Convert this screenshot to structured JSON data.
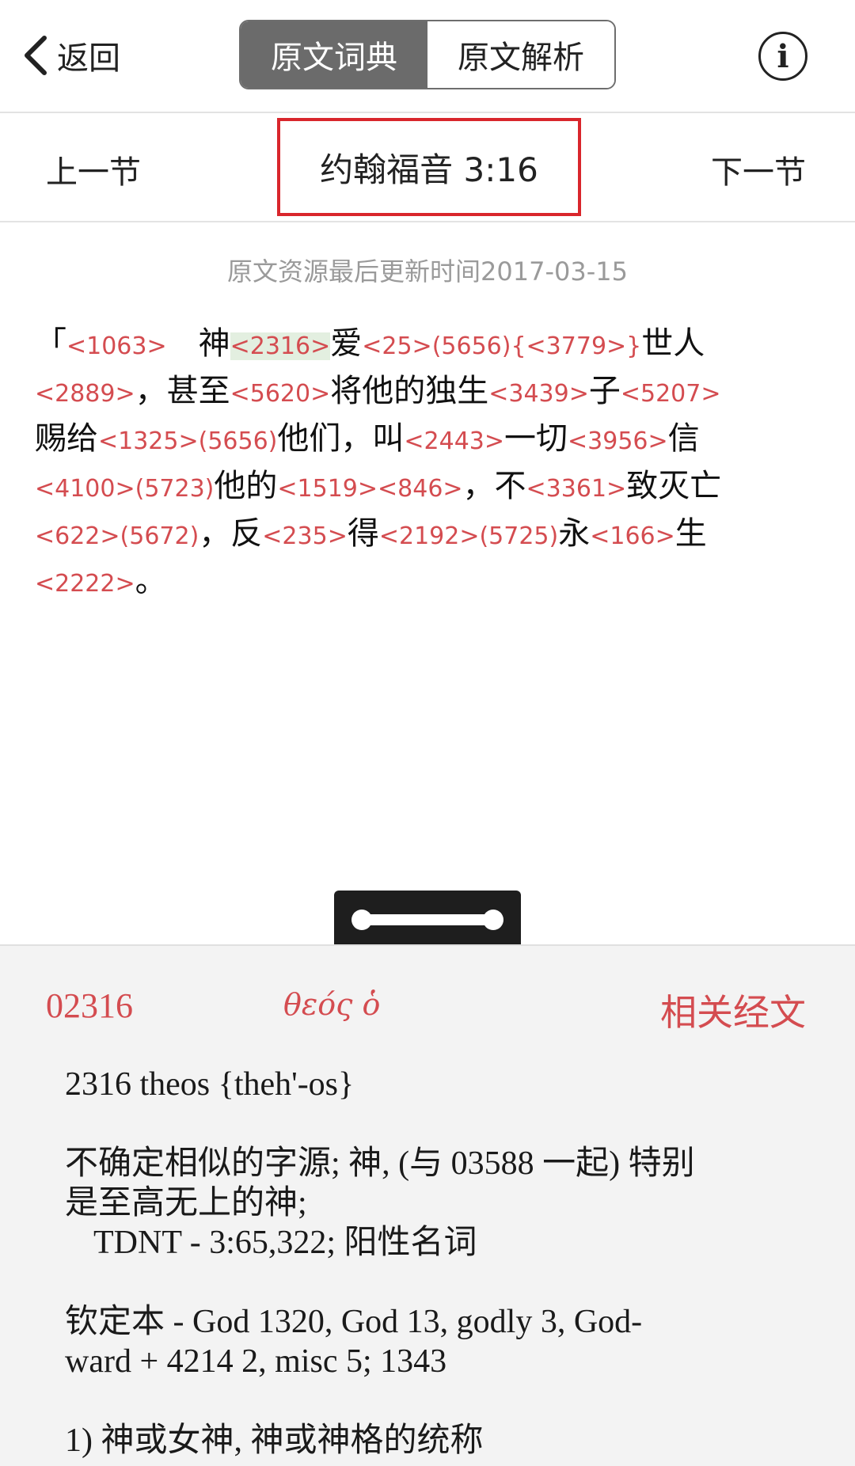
{
  "header": {
    "back_label": "返回",
    "tabs": [
      "原文词典",
      "原文解析"
    ],
    "info_glyph": "i"
  },
  "verse_nav": {
    "prev_label": "上一节",
    "reference": "约翰福音 3:16",
    "next_label": "下一节"
  },
  "updated_text": "原文资源最后更新时间2017-03-15",
  "verse_lines": [
    [
      {
        "t": "「",
        "k": "zh"
      },
      {
        "t": "<1063>",
        "k": "code"
      },
      {
        "t": "　神",
        "k": "zh"
      },
      {
        "t": "<2316>",
        "k": "code",
        "hl": true
      },
      {
        "t": "爱",
        "k": "zh"
      },
      {
        "t": "<25>(5656){<3779>}",
        "k": "code"
      },
      {
        "t": "世人",
        "k": "zh"
      }
    ],
    [
      {
        "t": "<2889>",
        "k": "code"
      },
      {
        "t": "，甚至",
        "k": "zh"
      },
      {
        "t": "<5620>",
        "k": "code"
      },
      {
        "t": "将他的独生",
        "k": "zh"
      },
      {
        "t": "<3439>",
        "k": "code"
      },
      {
        "t": "子",
        "k": "zh"
      },
      {
        "t": "<5207>",
        "k": "code"
      }
    ],
    [
      {
        "t": "赐给",
        "k": "zh"
      },
      {
        "t": "<1325>(5656)",
        "k": "code"
      },
      {
        "t": "他们，叫",
        "k": "zh"
      },
      {
        "t": "<2443>",
        "k": "code"
      },
      {
        "t": "一切",
        "k": "zh"
      },
      {
        "t": "<3956>",
        "k": "code"
      },
      {
        "t": "信",
        "k": "zh"
      }
    ],
    [
      {
        "t": "<4100>(5723)",
        "k": "code"
      },
      {
        "t": "他的",
        "k": "zh"
      },
      {
        "t": "<1519><846>",
        "k": "code"
      },
      {
        "t": "，不",
        "k": "zh"
      },
      {
        "t": "<3361>",
        "k": "code"
      },
      {
        "t": "致灭亡",
        "k": "zh"
      }
    ],
    [
      {
        "t": "<622>(5672)",
        "k": "code"
      },
      {
        "t": "，反",
        "k": "zh"
      },
      {
        "t": "<235>",
        "k": "code"
      },
      {
        "t": "得",
        "k": "zh"
      },
      {
        "t": "<2192>(5725)",
        "k": "code"
      },
      {
        "t": "永",
        "k": "zh"
      },
      {
        "t": "<166>",
        "k": "code"
      },
      {
        "t": "生",
        "k": "zh"
      }
    ],
    [
      {
        "t": "<2222>",
        "k": "code"
      },
      {
        "t": "。",
        "k": "zh"
      }
    ]
  ],
  "lexicon": {
    "strong_number": "02316",
    "greek": "θεός ὁ",
    "related_label": "相关经文",
    "entry_title": "2316 theos {theh'-os}",
    "etymology_line1": "不确定相似的字源; 神, (与 03588 一起) 特别",
    "etymology_line2": "是至高无上的神;",
    "tdnt_line": "TDNT - 3:65,322; 阳性名词",
    "kjv_line1": "钦定本 - God 1320, God 13, godly 3, God-",
    "kjv_line2": "ward + 4214 2, misc 5; 1343",
    "def_line1": "1) 神或女神, 神或神格的统称"
  },
  "colors": {
    "accent_red": "#d44c50",
    "highlight_box": "#d9262c",
    "active_tab": "#6b6b6b",
    "panel_bg": "#f3f3f3"
  },
  "icons": [
    "chevron-left-icon",
    "info-icon",
    "drag-handle-icon"
  ]
}
